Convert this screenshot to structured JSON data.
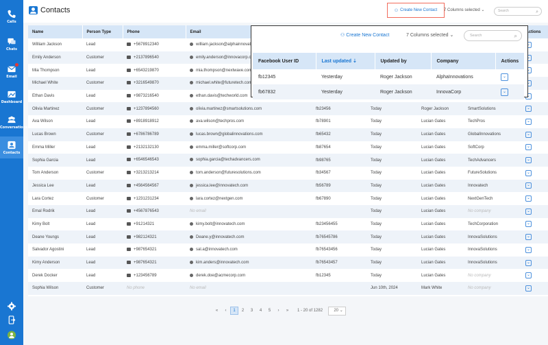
{
  "sidebar": {
    "items": [
      {
        "label": "Calls",
        "icon": "phone-icon"
      },
      {
        "label": "Chats",
        "icon": "chat-icon"
      },
      {
        "label": "Email",
        "icon": "email-icon"
      },
      {
        "label": "Dashboard",
        "icon": "dashboard-icon"
      },
      {
        "label": "Conversations",
        "icon": "people-icon"
      },
      {
        "label": "Contacts",
        "icon": "contacts-icon",
        "active": true
      }
    ],
    "bottom": [
      {
        "icon": "settings-icon"
      },
      {
        "icon": "logout-icon"
      },
      {
        "icon": "avatar"
      }
    ]
  },
  "header": {
    "title": "Contacts",
    "new_contact_label": "Create New Contact",
    "columns_selected": "7 Columns selected",
    "search_placeholder": "Search"
  },
  "table": {
    "columns": [
      "Name",
      "Person Type",
      "Phone",
      "Email",
      "",
      "",
      "",
      "",
      "Actions"
    ],
    "rows": [
      {
        "name": "William Jackson",
        "type": "Lead",
        "phone": "+5678912340",
        "email": "william.jackson@alphainnovations.com",
        "fb": "",
        "updated": "",
        "by": "",
        "company": ""
      },
      {
        "name": "Emily Anderson",
        "type": "Customer",
        "phone": "+2137896540",
        "email": "emily.anderson@innovacorp.com",
        "fb": "",
        "updated": "",
        "by": "",
        "company": ""
      },
      {
        "name": "Mia Thompson",
        "type": "Lead",
        "phone": "+6543219870",
        "email": "mia.thompson@nextwave.com",
        "fb": "",
        "updated": "",
        "by": "",
        "company": ""
      },
      {
        "name": "Michael White",
        "type": "Customer",
        "phone": "+3216549870",
        "email": "michael.white@futuretech.com",
        "fb": "",
        "updated": "",
        "by": "",
        "company": ""
      },
      {
        "name": "Ethan Davis",
        "type": "Lead",
        "phone": "+9873216540",
        "email": "ethan.davis@techworld.com",
        "fb": "",
        "updated": "",
        "by": "",
        "company": ""
      },
      {
        "name": "Olivia Martinez",
        "type": "Customer",
        "phone": "+1237894560",
        "email": "olivia.martinez@smartsolutions.com",
        "fb": "fb23456",
        "updated": "Today",
        "by": "Roger Jackson",
        "company": "SmartSolutions"
      },
      {
        "name": "Ava Wilson",
        "type": "Lead",
        "phone": "+8918918912",
        "email": "ava.wilson@techpros.com",
        "fb": "fb78901",
        "updated": "Today",
        "by": "Lucian Gates",
        "company": "TechPros"
      },
      {
        "name": "Lucas Brown",
        "type": "Customer",
        "phone": "+6786786789",
        "email": "lucas.brown@globalinnovations.com",
        "fb": "fb65432",
        "updated": "Today",
        "by": "Lucian Gates",
        "company": "GlobalInnovations"
      },
      {
        "name": "Emma Miller",
        "type": "Lead",
        "phone": "+2132132130",
        "email": "emma.miller@softcorp.com",
        "fb": "fb87654",
        "updated": "Today",
        "by": "Lucian Gates",
        "company": "SoftCorp"
      },
      {
        "name": "Sophia Garcia",
        "type": "Lead",
        "phone": "+6546546543",
        "email": "sophia.garcia@techadvancers.com",
        "fb": "fb98765",
        "updated": "Today",
        "by": "Lucian Gates",
        "company": "TechAdvancers"
      },
      {
        "name": "Tom Anderson",
        "type": "Customer",
        "phone": "+3213213214",
        "email": "tom.anderson@futuresolutions.com",
        "fb": "fb34567",
        "updated": "Today",
        "by": "Lucian Gates",
        "company": "FutureSolutions"
      },
      {
        "name": "Jessica Lee",
        "type": "Lead",
        "phone": "+4564564567",
        "email": "jessica.lee@innovatech.com",
        "fb": "fb56789",
        "updated": "Today",
        "by": "Lucian Gates",
        "company": "Innovatech"
      },
      {
        "name": "Lara Cortez",
        "type": "Customer",
        "phone": "+1231231234",
        "email": "lara.cortez@nextgen.com",
        "fb": "fb67890",
        "updated": "Today",
        "by": "Lucian Gates",
        "company": "NextGenTech"
      },
      {
        "name": "Emal Rodrik",
        "type": "Lead",
        "phone": "+4567876543",
        "email": "No email",
        "fb": "",
        "updated": "Today",
        "by": "Lucian Gates",
        "company": "No company"
      },
      {
        "name": "Kimy Bolt",
        "type": "Lead",
        "phone": "+91214321",
        "email": "kimy.bolt@innovatech.com",
        "fb": "fb23456455",
        "updated": "Today",
        "by": "Lucian Gates",
        "company": "TechCorporation"
      },
      {
        "name": "Deane Youngs",
        "type": "Lead",
        "phone": "+982124321",
        "email": "Deane.y@innovatech.com",
        "fb": "fb76545786",
        "updated": "Today",
        "by": "Lucian Gates",
        "company": "InnovaSolutions"
      },
      {
        "name": "Salvador Agostini",
        "type": "Lead",
        "phone": "+987654321",
        "email": "sal.a@innovatech.com",
        "fb": "fb76543456",
        "updated": "Today",
        "by": "Lucian Gates",
        "company": "InnovaSolutions"
      },
      {
        "name": "Kimy Anderson",
        "type": "Lead",
        "phone": "+987654321",
        "email": "kim.anders@innovatech.com",
        "fb": "fb76543457",
        "updated": "Today",
        "by": "Lucian Gates",
        "company": "InnovaSolutions"
      },
      {
        "name": "Derek Docker",
        "type": "Lead",
        "phone": "+123456789",
        "email": "derek.doe@acmecorp.com",
        "fb": "fb12345",
        "updated": "Today",
        "by": "Lucian Gates",
        "company": "No company"
      },
      {
        "name": "Sophia Wilson",
        "type": "Customer",
        "phone": "No phone",
        "email": "No email",
        "fb": "",
        "updated": "Jun 10th, 2024",
        "by": "Mark White",
        "company": "No company"
      }
    ]
  },
  "pagination": {
    "pages": [
      "1",
      "2",
      "3",
      "4",
      "5"
    ],
    "active_page": "1",
    "range": "1 - 20 of 1282",
    "per_page": "20"
  },
  "zoom": {
    "new_contact_label": "Create New Contact",
    "columns_selected": "7 Columns selected",
    "search_placeholder": "Search",
    "columns": [
      "Facebook User ID",
      "Last updated",
      "Updated by",
      "Company",
      "Actions"
    ],
    "rows": [
      {
        "fb": "fb12345",
        "updated": "Yesterday",
        "by": "Roger Jackson",
        "company": "AlphaInnovations"
      },
      {
        "fb": "fb67832",
        "updated": "Yesterday",
        "by": "Roger Jackson",
        "company": "InnovaCorp"
      }
    ]
  },
  "colors": {
    "primary": "#1976d2",
    "header_row": "#d6e6f7",
    "highlight_border": "#f26b5b"
  }
}
